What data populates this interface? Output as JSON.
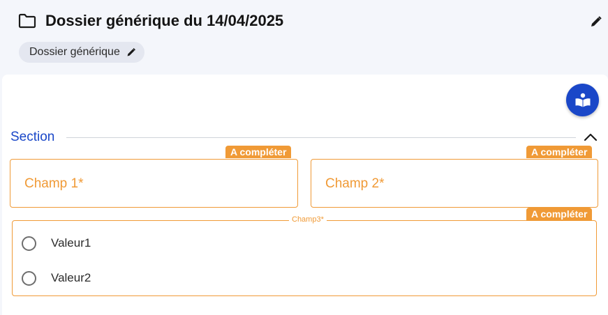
{
  "header": {
    "title": "Dossier générique du 14/04/2025",
    "folder_icon": "folder-icon",
    "edit_icon": "pencil-icon",
    "chip": {
      "label": "Dossier générique",
      "icon": "pencil-icon"
    }
  },
  "toolbar": {
    "help_icon": "open-book-icon"
  },
  "section": {
    "title": "Section",
    "collapse_icon": "chevron-up-icon",
    "fields": [
      {
        "badge": "A compléter",
        "label": "Champ 1*"
      },
      {
        "badge": "A compléter",
        "label": "Champ 2*"
      }
    ],
    "radio_group": {
      "badge": "A compléter",
      "legend": "Champ3*",
      "options": [
        {
          "label": "Valeur1",
          "selected": false
        },
        {
          "label": "Valeur2",
          "selected": false
        }
      ]
    }
  },
  "colors": {
    "accent_blue": "#1a47c8",
    "required_orange": "#f09a36",
    "header_bg": "#f4f6fb",
    "chip_bg": "#e4e7f0"
  }
}
